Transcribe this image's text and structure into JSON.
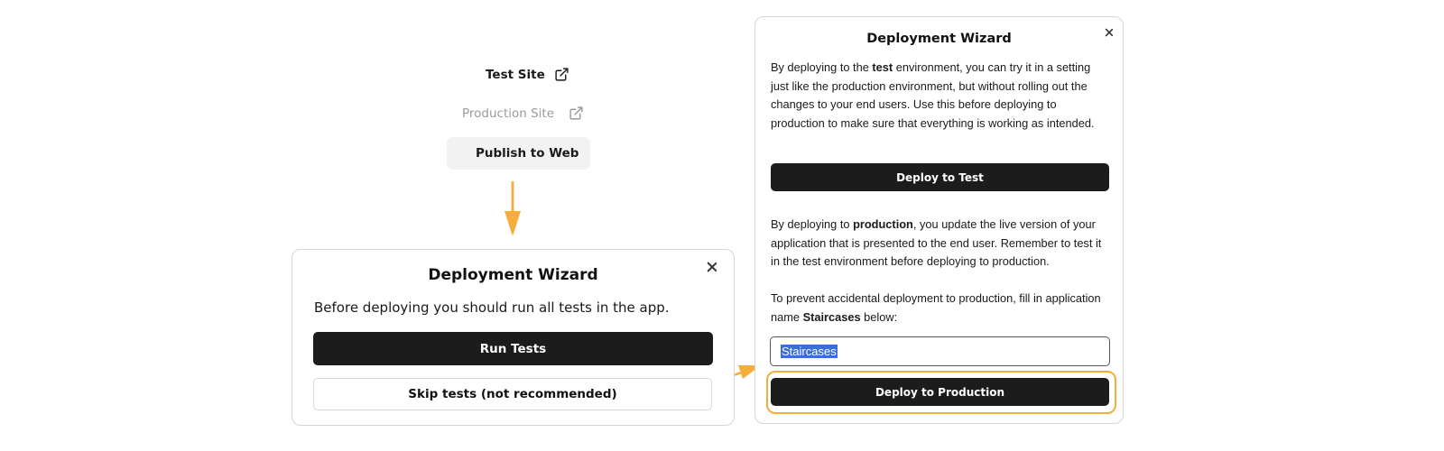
{
  "menu": {
    "test_site_label": "Test Site",
    "production_site_label": "Production Site",
    "publish_label": "Publish to Web"
  },
  "wizard_left": {
    "title": "Deployment Wizard",
    "message": "Before deploying you should run all tests in the app.",
    "run_tests_label": "Run Tests",
    "skip_tests_label": "Skip tests (not recommended)"
  },
  "wizard_right": {
    "title": "Deployment Wizard",
    "test_para": {
      "pre": "By deploying to the ",
      "bold": "test",
      "post": " environment, you can try it in a setting just like the production environment, but without rolling out the changes to your end users. Use this before deploying to production to make sure that everything is working as intended."
    },
    "deploy_test_label": "Deploy to Test",
    "prod_para": {
      "pre": "By deploying to ",
      "bold": "production",
      "post": ", you update the live version of your application that is presented to the end user. Remember to test it in the test environment before deploying to production."
    },
    "prevent_para": {
      "pre": "To prevent accidental deployment to production, fill in application name ",
      "bold": "Staircases",
      "post": " below:"
    },
    "app_name_value": "Staircases",
    "deploy_prod_label": "Deploy to Production"
  },
  "colors": {
    "accent_arrow": "#f5ad3c",
    "button_dark": "#1c1c1c",
    "selection": "#3a6fd8"
  },
  "icons": {
    "external_link": "external-link-icon",
    "send": "send-icon",
    "close": "close-icon"
  }
}
